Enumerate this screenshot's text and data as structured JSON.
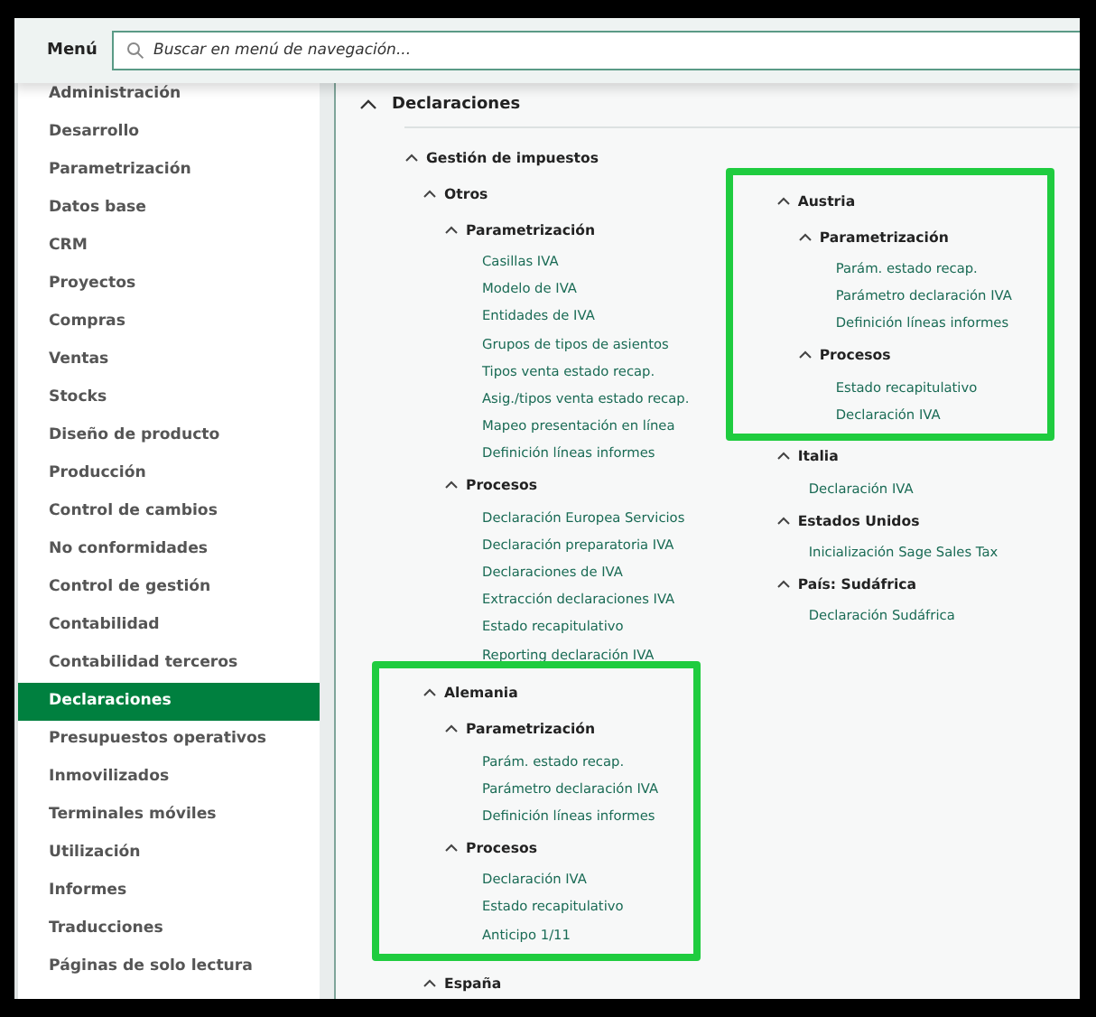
{
  "menu_label": "Menú",
  "search": {
    "placeholder": "Buscar en menú de navegación..."
  },
  "sidebar": {
    "items": [
      {
        "label": "Administración",
        "selected": false
      },
      {
        "label": "Desarrollo",
        "selected": false
      },
      {
        "label": "Parametrización",
        "selected": false
      },
      {
        "label": "Datos base",
        "selected": false
      },
      {
        "label": "CRM",
        "selected": false
      },
      {
        "label": "Proyectos",
        "selected": false
      },
      {
        "label": "Compras",
        "selected": false
      },
      {
        "label": "Ventas",
        "selected": false
      },
      {
        "label": "Stocks",
        "selected": false
      },
      {
        "label": "Diseño de producto",
        "selected": false
      },
      {
        "label": "Producción",
        "selected": false
      },
      {
        "label": "Control de cambios",
        "selected": false
      },
      {
        "label": "No conformidades",
        "selected": false
      },
      {
        "label": "Control de gestión",
        "selected": false
      },
      {
        "label": "Contabilidad",
        "selected": false
      },
      {
        "label": "Contabilidad terceros",
        "selected": false
      },
      {
        "label": "Declaraciones",
        "selected": true
      },
      {
        "label": "Presupuestos operativos",
        "selected": false
      },
      {
        "label": "Inmovilizados",
        "selected": false
      },
      {
        "label": "Terminales móviles",
        "selected": false
      },
      {
        "label": "Utilización",
        "selected": false
      },
      {
        "label": "Informes",
        "selected": false
      },
      {
        "label": "Traducciones",
        "selected": false
      },
      {
        "label": "Páginas de solo lectura",
        "selected": false
      }
    ]
  },
  "section": {
    "title": "Declaraciones",
    "expanded": true,
    "group": {
      "title": "Gestión de impuestos",
      "expanded": true,
      "columns": [
        [
          {
            "title": "Otros",
            "expanded": true,
            "highlighted": false,
            "children": [
              {
                "kind": "group",
                "title": "Parametrización",
                "expanded": true,
                "children": [
                  {
                    "kind": "link",
                    "label": "Casillas IVA"
                  },
                  {
                    "kind": "link",
                    "label": "Modelo de IVA"
                  },
                  {
                    "kind": "link",
                    "label": "Entidades de IVA"
                  },
                  {
                    "kind": "link",
                    "label": "Grupos de tipos de asientos"
                  },
                  {
                    "kind": "link",
                    "label": "Tipos venta estado recap."
                  },
                  {
                    "kind": "link",
                    "label": "Asig./tipos venta estado recap."
                  },
                  {
                    "kind": "link",
                    "label": "Mapeo presentación en línea"
                  },
                  {
                    "kind": "link",
                    "label": "Definición líneas informes"
                  }
                ]
              },
              {
                "kind": "group",
                "title": "Procesos",
                "expanded": true,
                "children": [
                  {
                    "kind": "link",
                    "label": "Declaración Europea Servicios"
                  },
                  {
                    "kind": "link",
                    "label": "Declaración preparatoria IVA"
                  },
                  {
                    "kind": "link",
                    "label": "Declaraciones de IVA"
                  },
                  {
                    "kind": "link",
                    "label": "Extracción declaraciones IVA"
                  },
                  {
                    "kind": "link",
                    "label": "Estado recapitulativo"
                  },
                  {
                    "kind": "link",
                    "label": "Reporting declaración IVA"
                  }
                ]
              }
            ]
          },
          {
            "title": "Alemania",
            "expanded": true,
            "highlighted": true,
            "children": [
              {
                "kind": "group",
                "title": "Parametrización",
                "expanded": true,
                "children": [
                  {
                    "kind": "link",
                    "label": "Parám. estado recap."
                  },
                  {
                    "kind": "link",
                    "label": "Parámetro declaración IVA"
                  },
                  {
                    "kind": "link",
                    "label": "Definición líneas informes"
                  }
                ]
              },
              {
                "kind": "group",
                "title": "Procesos",
                "expanded": true,
                "children": [
                  {
                    "kind": "link",
                    "label": "Declaración IVA"
                  },
                  {
                    "kind": "link",
                    "label": "Estado recapitulativo"
                  },
                  {
                    "kind": "link",
                    "label": "Anticipo 1/11"
                  }
                ]
              }
            ]
          },
          {
            "title": "España",
            "expanded": true,
            "highlighted": false
          }
        ],
        [
          {
            "title": "Austria",
            "expanded": true,
            "highlighted": true,
            "children": [
              {
                "kind": "group",
                "title": "Parametrización",
                "expanded": true,
                "children": [
                  {
                    "kind": "link",
                    "label": "Parám. estado recap."
                  },
                  {
                    "kind": "link",
                    "label": "Parámetro declaración IVA"
                  },
                  {
                    "kind": "link",
                    "label": "Definición líneas informes"
                  }
                ]
              },
              {
                "kind": "group",
                "title": "Procesos",
                "expanded": true,
                "children": [
                  {
                    "kind": "link",
                    "label": "Estado recapitulativo"
                  },
                  {
                    "kind": "link",
                    "label": "Declaración IVA"
                  }
                ]
              }
            ]
          },
          {
            "title": "Italia",
            "expanded": true,
            "highlighted": false,
            "children": [
              {
                "kind": "link",
                "label": "Declaración IVA"
              }
            ]
          },
          {
            "title": "Estados Unidos",
            "expanded": true,
            "highlighted": false,
            "children": [
              {
                "kind": "link",
                "label": "Inicialización Sage Sales Tax"
              }
            ]
          },
          {
            "title": "País: Sudáfrica",
            "expanded": true,
            "highlighted": false,
            "children": [
              {
                "kind": "link",
                "label": "Declaración Sudáfrica"
              }
            ]
          }
        ]
      ]
    }
  }
}
